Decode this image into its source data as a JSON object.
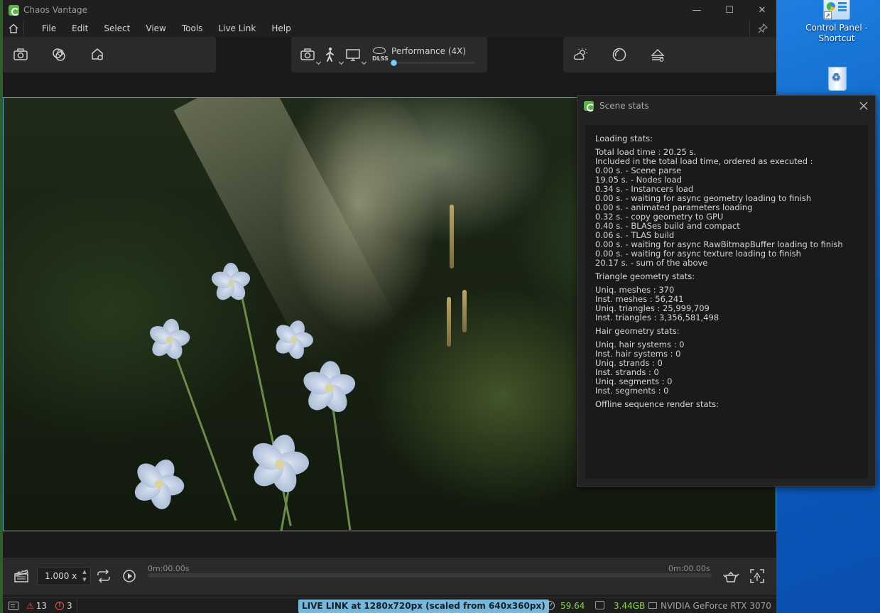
{
  "window": {
    "title": "Chaos Vantage",
    "minimize": "—",
    "maximize": "☐",
    "close": "✕"
  },
  "menu": {
    "items": [
      "File",
      "Edit",
      "Select",
      "View",
      "Tools",
      "Live Link",
      "Help"
    ]
  },
  "toolbar": {
    "left_icons": [
      "camera-icon",
      "materials-icon",
      "environment-settings-icon"
    ],
    "mid_icons": [
      "camera-view-icon",
      "walk-mode-icon",
      "display-icon"
    ],
    "dlss_label": "DLSS",
    "performance_label": "Performance (4X)",
    "performance_level": 0.0,
    "right_icons": [
      "sun-cloud-icon",
      "exposure-icon",
      "lens-effects-icon"
    ]
  },
  "stats_panel": {
    "title": "Scene stats",
    "close": "✕",
    "sections": [
      {
        "title": "Loading stats:",
        "lines": [
          "Total load time : 20.25 s.",
          "Included in the total load time, ordered as executed :",
          "0.00 s. - Scene parse",
          "19.05 s. - Nodes load",
          "0.34 s. - Instancers load",
          "0.00 s. - waiting for async geometry loading to finish",
          "0.00 s. - animated parameters loading",
          "0.32 s. - copy geometry to GPU",
          "0.40 s. - BLASes build and compact",
          "0.06 s. - TLAS build",
          "0.00 s. - waiting for async RawBitmapBuffer loading to finish",
          "0.00 s. - waiting for async texture loading to finish",
          "20.17 s. - sum of the above"
        ]
      },
      {
        "title": "Triangle geometry stats:",
        "lines": [
          "Uniq. meshes : 370",
          "Inst. meshes : 56,241",
          "Uniq. triangles : 25,999,709",
          "Inst. triangles : 3,356,581,498"
        ]
      },
      {
        "title": "Hair geometry stats:",
        "lines": [
          "Uniq. hair systems : 0",
          "Inst. hair systems : 0",
          "Uniq. strands : 0",
          "Inst. strands : 0",
          "Uniq. segments : 0",
          "Inst. segments : 0"
        ]
      },
      {
        "title": "Offline sequence render stats:",
        "lines": []
      }
    ]
  },
  "timeline": {
    "speed": "1.000 x",
    "spin_up": "▲",
    "spin_down": "▼",
    "time_start": "0m:00.00s",
    "time_end": "0m:00.00s"
  },
  "statusbar": {
    "warning_icon": "⚠",
    "warnings": "13",
    "error_icon": "!",
    "errors": "3",
    "live_link": "LIVE LINK at 1280x720px (scaled from 640x360px)",
    "fps": "59.64",
    "memory": "3.44GB",
    "gpu": "NVIDIA GeForce RTX 3070"
  },
  "desktop": {
    "control_panel_label": "Control Panel - Shortcut",
    "shortcut_arrow": "↗"
  }
}
